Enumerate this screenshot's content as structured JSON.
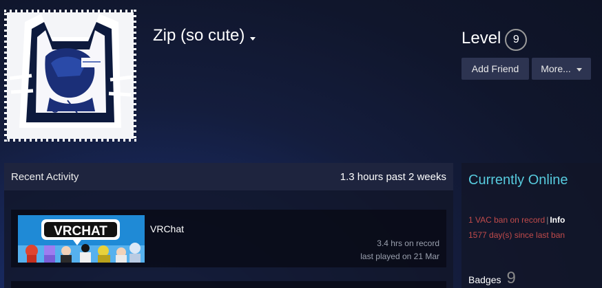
{
  "profile": {
    "name": "Zip (so cute)",
    "level_label": "Level",
    "level": "9",
    "add_friend": "Add Friend",
    "more": "More..."
  },
  "recent": {
    "title": "Recent Activity",
    "hours": "1.3 hours past 2 weeks",
    "games": [
      {
        "name": "VRChat",
        "thumb_text": "VRCHAT",
        "hours_on_record": "3.4 hrs on record",
        "last_played": "last played on 21 Mar"
      }
    ]
  },
  "sidebar": {
    "status": "Currently Online",
    "vac": "1 VAC ban on record",
    "sep": "|",
    "info": "Info",
    "days": "1577 day(s) since last ban",
    "badges_label": "Badges",
    "badges_count": "9"
  },
  "colors": {
    "online": "#57cbde",
    "ban": "#c24b4b"
  }
}
